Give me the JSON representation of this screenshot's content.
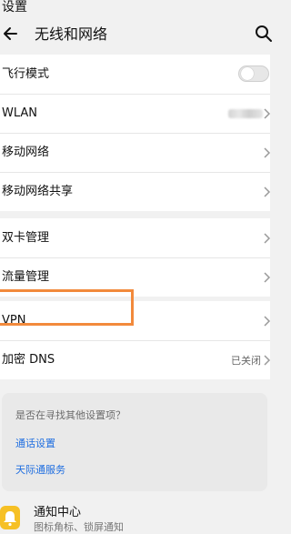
{
  "app_label": "设置",
  "header": {
    "title": "无线和网络"
  },
  "rows": {
    "airplane": {
      "label": "飞行模式",
      "toggle_on": false
    },
    "wlan": {
      "label": "WLAN"
    },
    "mobile_network": {
      "label": "移动网络"
    },
    "tethering": {
      "label": "移动网络共享"
    },
    "dual_sim": {
      "label": "双卡管理"
    },
    "data_usage": {
      "label": "流量管理"
    },
    "vpn": {
      "label": "VPN"
    },
    "private_dns": {
      "label": "加密 DNS",
      "value": "已关闭"
    }
  },
  "suggestions": {
    "title": "是否在寻找其他设置项？",
    "links": [
      "通话设置",
      "天际通服务"
    ]
  },
  "notification": {
    "title": "通知中心",
    "subtitle": "图标角标、锁屏通知"
  },
  "colors": {
    "highlight": "#f28a3c",
    "link": "#1f6ee0",
    "notification_icon": "#f6c025"
  }
}
